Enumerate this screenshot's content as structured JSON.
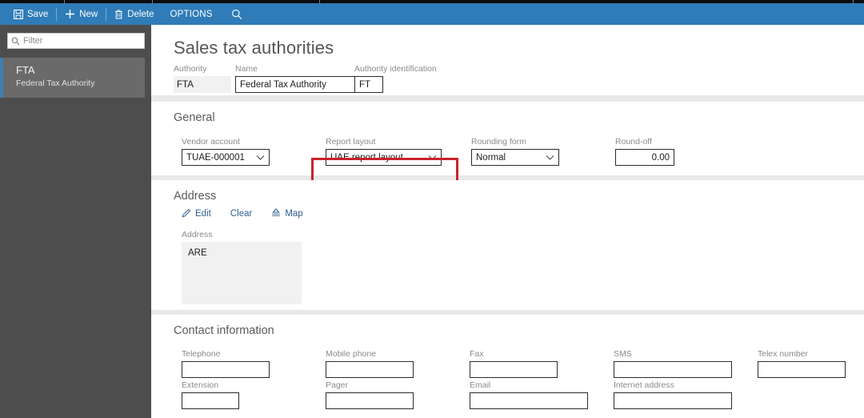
{
  "colors": {
    "command_bar": "#2f7cb8",
    "nav_pane": "#4d4d4d",
    "nav_selected": "#6a6a6a",
    "nav_accent": "#3d7fb5",
    "highlight": "#c9232d",
    "content_bg": "#e9e9e9"
  },
  "command_bar": {
    "save_label": "Save",
    "new_label": "New",
    "delete_label": "Delete",
    "options_label": "OPTIONS",
    "search_icon": "search-icon",
    "save_icon": "save-disk-icon",
    "new_icon": "plus-icon",
    "delete_icon": "trash-icon"
  },
  "nav": {
    "filter_placeholder": "Filter",
    "filter_value": "",
    "filter_icon": "search-icon",
    "items": [
      {
        "title": "FTA",
        "subtitle": "Federal Tax Authority",
        "selected": true
      }
    ]
  },
  "page": {
    "title": "Sales tax authorities"
  },
  "header_fields": [
    {
      "label": "Authority",
      "value": "FTA",
      "readonly": true,
      "name": "authority-field"
    },
    {
      "label": "Name",
      "value": "Federal Tax Authority",
      "readonly": false,
      "name": "name-field"
    },
    {
      "label": "Authority identification",
      "value": "FT",
      "readonly": false,
      "name": "authority-identification-field"
    }
  ],
  "general": {
    "title": "General",
    "vendor_account": {
      "label": "Vendor account",
      "value": "TUAE-000001"
    },
    "report_layout": {
      "label": "Report layout",
      "value": "UAE report layout",
      "highlighted": true
    },
    "rounding_form": {
      "label": "Rounding form",
      "value": "Normal"
    },
    "round_off": {
      "label": "Round-off",
      "value": "0.00"
    }
  },
  "address": {
    "title": "Address",
    "edit_label": "Edit",
    "clear_label": "Clear",
    "map_label": "Map",
    "edit_icon": "pencil-icon",
    "map_icon": "map-pin-icon",
    "field_label": "Address",
    "value": "ARE"
  },
  "contact": {
    "title": "Contact information",
    "fields": [
      {
        "label": "Telephone",
        "value": "",
        "name": "telephone-field"
      },
      {
        "label": "Mobile phone",
        "value": "",
        "name": "mobile-phone-field"
      },
      {
        "label": "Fax",
        "value": "",
        "name": "fax-field"
      },
      {
        "label": "SMS",
        "value": "",
        "name": "sms-field"
      },
      {
        "label": "Telex number",
        "value": "",
        "name": "telex-number-field"
      },
      {
        "label": "Extension",
        "value": "",
        "name": "extension-field"
      },
      {
        "label": "Pager",
        "value": "",
        "name": "pager-field"
      },
      {
        "label": "Email",
        "value": "",
        "name": "email-field"
      },
      {
        "label": "Internet address",
        "value": "",
        "name": "internet-address-field"
      }
    ]
  }
}
